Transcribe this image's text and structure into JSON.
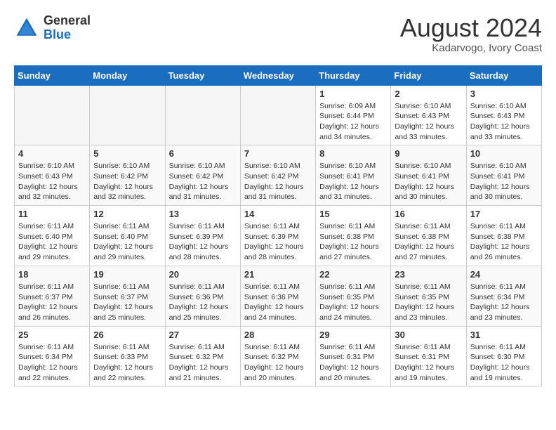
{
  "header": {
    "logo_general": "General",
    "logo_blue": "Blue",
    "month_year": "August 2024",
    "location": "Kadarvogo, Ivory Coast"
  },
  "days_of_week": [
    "Sunday",
    "Monday",
    "Tuesday",
    "Wednesday",
    "Thursday",
    "Friday",
    "Saturday"
  ],
  "weeks": [
    [
      {
        "day": "",
        "empty": true
      },
      {
        "day": "",
        "empty": true
      },
      {
        "day": "",
        "empty": true
      },
      {
        "day": "",
        "empty": true
      },
      {
        "day": "1",
        "sunrise": "Sunrise: 6:09 AM",
        "sunset": "Sunset: 6:44 PM",
        "daylight": "Daylight: 12 hours and 34 minutes."
      },
      {
        "day": "2",
        "sunrise": "Sunrise: 6:10 AM",
        "sunset": "Sunset: 6:43 PM",
        "daylight": "Daylight: 12 hours and 33 minutes."
      },
      {
        "day": "3",
        "sunrise": "Sunrise: 6:10 AM",
        "sunset": "Sunset: 6:43 PM",
        "daylight": "Daylight: 12 hours and 33 minutes."
      }
    ],
    [
      {
        "day": "4",
        "sunrise": "Sunrise: 6:10 AM",
        "sunset": "Sunset: 6:43 PM",
        "daylight": "Daylight: 12 hours and 32 minutes."
      },
      {
        "day": "5",
        "sunrise": "Sunrise: 6:10 AM",
        "sunset": "Sunset: 6:42 PM",
        "daylight": "Daylight: 12 hours and 32 minutes."
      },
      {
        "day": "6",
        "sunrise": "Sunrise: 6:10 AM",
        "sunset": "Sunset: 6:42 PM",
        "daylight": "Daylight: 12 hours and 31 minutes."
      },
      {
        "day": "7",
        "sunrise": "Sunrise: 6:10 AM",
        "sunset": "Sunset: 6:42 PM",
        "daylight": "Daylight: 12 hours and 31 minutes."
      },
      {
        "day": "8",
        "sunrise": "Sunrise: 6:10 AM",
        "sunset": "Sunset: 6:41 PM",
        "daylight": "Daylight: 12 hours and 31 minutes."
      },
      {
        "day": "9",
        "sunrise": "Sunrise: 6:10 AM",
        "sunset": "Sunset: 6:41 PM",
        "daylight": "Daylight: 12 hours and 30 minutes."
      },
      {
        "day": "10",
        "sunrise": "Sunrise: 6:10 AM",
        "sunset": "Sunset: 6:41 PM",
        "daylight": "Daylight: 12 hours and 30 minutes."
      }
    ],
    [
      {
        "day": "11",
        "sunrise": "Sunrise: 6:11 AM",
        "sunset": "Sunset: 6:40 PM",
        "daylight": "Daylight: 12 hours and 29 minutes."
      },
      {
        "day": "12",
        "sunrise": "Sunrise: 6:11 AM",
        "sunset": "Sunset: 6:40 PM",
        "daylight": "Daylight: 12 hours and 29 minutes."
      },
      {
        "day": "13",
        "sunrise": "Sunrise: 6:11 AM",
        "sunset": "Sunset: 6:39 PM",
        "daylight": "Daylight: 12 hours and 28 minutes."
      },
      {
        "day": "14",
        "sunrise": "Sunrise: 6:11 AM",
        "sunset": "Sunset: 6:39 PM",
        "daylight": "Daylight: 12 hours and 28 minutes."
      },
      {
        "day": "15",
        "sunrise": "Sunrise: 6:11 AM",
        "sunset": "Sunset: 6:38 PM",
        "daylight": "Daylight: 12 hours and 27 minutes."
      },
      {
        "day": "16",
        "sunrise": "Sunrise: 6:11 AM",
        "sunset": "Sunset: 6:38 PM",
        "daylight": "Daylight: 12 hours and 27 minutes."
      },
      {
        "day": "17",
        "sunrise": "Sunrise: 6:11 AM",
        "sunset": "Sunset: 6:38 PM",
        "daylight": "Daylight: 12 hours and 26 minutes."
      }
    ],
    [
      {
        "day": "18",
        "sunrise": "Sunrise: 6:11 AM",
        "sunset": "Sunset: 6:37 PM",
        "daylight": "Daylight: 12 hours and 26 minutes."
      },
      {
        "day": "19",
        "sunrise": "Sunrise: 6:11 AM",
        "sunset": "Sunset: 6:37 PM",
        "daylight": "Daylight: 12 hours and 25 minutes."
      },
      {
        "day": "20",
        "sunrise": "Sunrise: 6:11 AM",
        "sunset": "Sunset: 6:36 PM",
        "daylight": "Daylight: 12 hours and 25 minutes."
      },
      {
        "day": "21",
        "sunrise": "Sunrise: 6:11 AM",
        "sunset": "Sunset: 6:36 PM",
        "daylight": "Daylight: 12 hours and 24 minutes."
      },
      {
        "day": "22",
        "sunrise": "Sunrise: 6:11 AM",
        "sunset": "Sunset: 6:35 PM",
        "daylight": "Daylight: 12 hours and 24 minutes."
      },
      {
        "day": "23",
        "sunrise": "Sunrise: 6:11 AM",
        "sunset": "Sunset: 6:35 PM",
        "daylight": "Daylight: 12 hours and 23 minutes."
      },
      {
        "day": "24",
        "sunrise": "Sunrise: 6:11 AM",
        "sunset": "Sunset: 6:34 PM",
        "daylight": "Daylight: 12 hours and 23 minutes."
      }
    ],
    [
      {
        "day": "25",
        "sunrise": "Sunrise: 6:11 AM",
        "sunset": "Sunset: 6:34 PM",
        "daylight": "Daylight: 12 hours and 22 minutes."
      },
      {
        "day": "26",
        "sunrise": "Sunrise: 6:11 AM",
        "sunset": "Sunset: 6:33 PM",
        "daylight": "Daylight: 12 hours and 22 minutes."
      },
      {
        "day": "27",
        "sunrise": "Sunrise: 6:11 AM",
        "sunset": "Sunset: 6:32 PM",
        "daylight": "Daylight: 12 hours and 21 minutes."
      },
      {
        "day": "28",
        "sunrise": "Sunrise: 6:11 AM",
        "sunset": "Sunset: 6:32 PM",
        "daylight": "Daylight: 12 hours and 20 minutes."
      },
      {
        "day": "29",
        "sunrise": "Sunrise: 6:11 AM",
        "sunset": "Sunset: 6:31 PM",
        "daylight": "Daylight: 12 hours and 20 minutes."
      },
      {
        "day": "30",
        "sunrise": "Sunrise: 6:11 AM",
        "sunset": "Sunset: 6:31 PM",
        "daylight": "Daylight: 12 hours and 19 minutes."
      },
      {
        "day": "31",
        "sunrise": "Sunrise: 6:11 AM",
        "sunset": "Sunset: 6:30 PM",
        "daylight": "Daylight: 12 hours and 19 minutes."
      }
    ]
  ]
}
